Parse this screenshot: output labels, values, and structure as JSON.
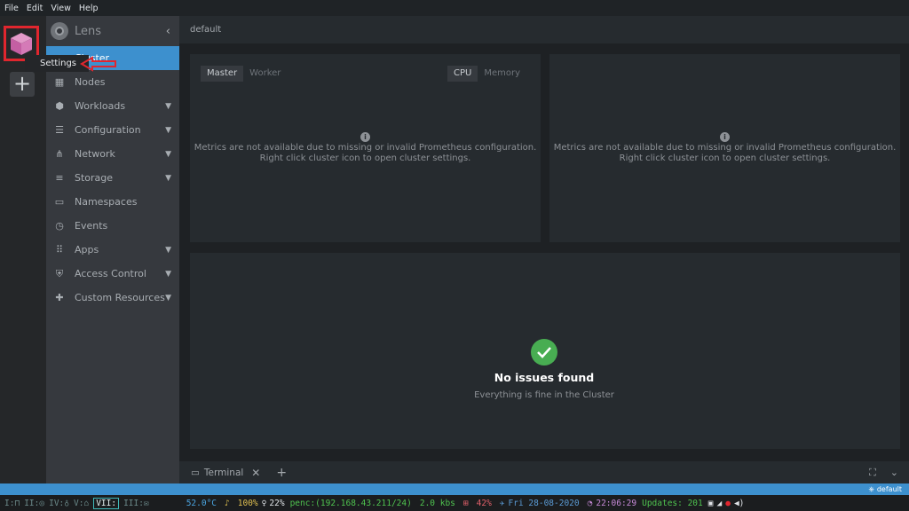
{
  "menubar": [
    "File",
    "Edit",
    "View",
    "Help"
  ],
  "tooltip": "Settings",
  "sidebar": {
    "title": "Lens",
    "items": [
      {
        "label": "Cluster",
        "icon": "cluster-icon",
        "active": true,
        "expandable": false
      },
      {
        "label": "Nodes",
        "icon": "nodes-icon",
        "active": false,
        "expandable": false
      },
      {
        "label": "Workloads",
        "icon": "workloads-icon",
        "active": false,
        "expandable": true
      },
      {
        "label": "Configuration",
        "icon": "list-icon",
        "active": false,
        "expandable": true
      },
      {
        "label": "Network",
        "icon": "network-icon",
        "active": false,
        "expandable": true
      },
      {
        "label": "Storage",
        "icon": "storage-icon",
        "active": false,
        "expandable": true
      },
      {
        "label": "Namespaces",
        "icon": "namespaces-icon",
        "active": false,
        "expandable": false
      },
      {
        "label": "Events",
        "icon": "clock-icon",
        "active": false,
        "expandable": false
      },
      {
        "label": "Apps",
        "icon": "apps-grid-icon",
        "active": false,
        "expandable": true
      },
      {
        "label": "Access Control",
        "icon": "shield-icon",
        "active": false,
        "expandable": true
      },
      {
        "label": "Custom Resources",
        "icon": "puzzle-icon",
        "active": false,
        "expandable": true
      }
    ]
  },
  "main": {
    "breadcrumb": "default",
    "panel1": {
      "tabs_left": [
        "Master",
        "Worker"
      ],
      "tabs_right": [
        "CPU",
        "Memory"
      ],
      "msg1": "Metrics are not available due to missing or invalid Prometheus configuration.",
      "msg2": "Right click cluster icon to open cluster settings."
    },
    "panel2": {
      "msg1": "Metrics are not available due to missing or invalid Prometheus configuration.",
      "msg2": "Right click cluster icon to open cluster settings."
    },
    "issues": {
      "title": "No issues found",
      "subtitle": "Everything is fine in the Cluster"
    },
    "terminal": {
      "label": "Terminal"
    }
  },
  "statusbar": {
    "context": "default"
  },
  "taskbar": {
    "workspaces": [
      "I:",
      "II:",
      "IV:",
      "V:",
      "VII:",
      "III:"
    ],
    "temp": "52.0°C",
    "battery": "100%",
    "brightness": "22%",
    "network": "penc:(192.168.43.211/24)",
    "speed": "2.0 kbs",
    "cpu": "42%",
    "datetime": "Fri 28-08-2020",
    "time": "22:06:29",
    "updates": "Updates: 201",
    "colors": {
      "temp": "#4aa3df",
      "network": "#4fc34f",
      "cpu": "#e0606a",
      "date": "#5b9bd5",
      "time": "#c78ad8",
      "updates": "#4fc34f"
    }
  }
}
